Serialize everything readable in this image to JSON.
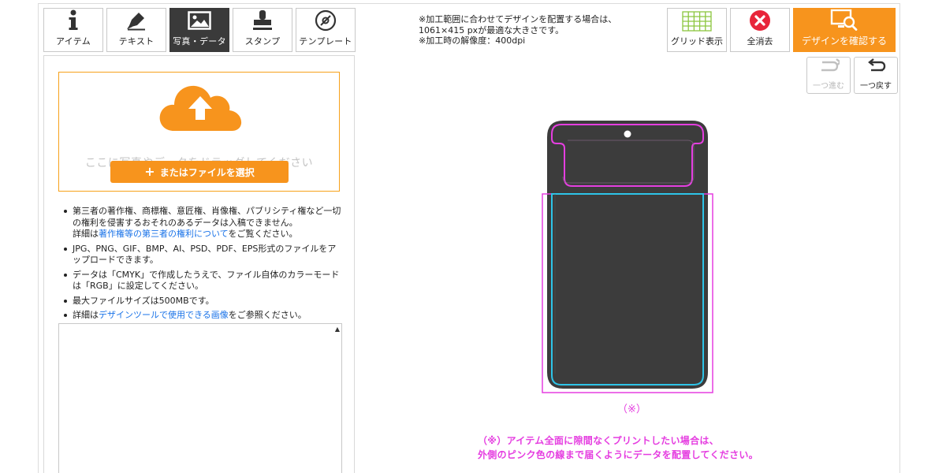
{
  "tool_tabs": [
    {
      "label": "アイテム",
      "icon": "info-icon",
      "active": false
    },
    {
      "label": "テキスト",
      "icon": "pen-icon",
      "active": false
    },
    {
      "label": "写真・データ",
      "icon": "image-icon",
      "active": true
    },
    {
      "label": "スタンプ",
      "icon": "stamp-icon",
      "active": false
    },
    {
      "label": "テンプレート",
      "icon": "disc-icon",
      "active": false
    }
  ],
  "upload": {
    "drop_text": "ここに写真やデータをドラッグしてください",
    "select_label": "またはファイルを選択",
    "plus": "+"
  },
  "notes": {
    "n1_a": "第三者の著作権、商標権、意匠権、肖像権、パブリシティ権など一切の権利を侵害するおそれのあるデータは入稿できません。",
    "n1_b": "詳細は",
    "n1_link": "著作権等の第三者の権利について",
    "n1_c": "をご覧ください。",
    "n2": "JPG、PNG、GIF、BMP、AI、PSD、PDF、EPS形式のファイルをアップロードできます。",
    "n3": "データは「CMYK」で作成したうえで、ファイル自体のカラーモードは「RGB」に設定してください。",
    "n4": "最大ファイルサイズは500MBです。",
    "n5_a": "詳細は",
    "n5_link": "デザインツールで使用できる画像",
    "n5_b": "をご参照ください。"
  },
  "info": {
    "line1": "※加工範囲に合わせてデザインを配置する場合は、",
    "line2": "1061×415 pxが最適な大きさです。",
    "line3": "※加工時の解像度：400dpi"
  },
  "toolbar": {
    "grid_label": "グリッド表示",
    "clear_label": "全消去",
    "confirm_label": "デザインを確認する",
    "redo_label": "一つ進む",
    "undo_label": "一つ戻す"
  },
  "canvas": {
    "mark": "（※）",
    "message_line1": "（※）アイテム全面に隙間なくプリントしたい場合は、",
    "message_line2": "外側のピンク色の線まで届くようにデータを配置してください。"
  },
  "colors": {
    "accent": "#f7941d",
    "pink_guide": "#e53ee0",
    "cyan_guide": "#2ec4e8",
    "item_body": "#3c3c3c",
    "clear_icon": "#e8253a",
    "grid_icon": "#8cc63f"
  }
}
